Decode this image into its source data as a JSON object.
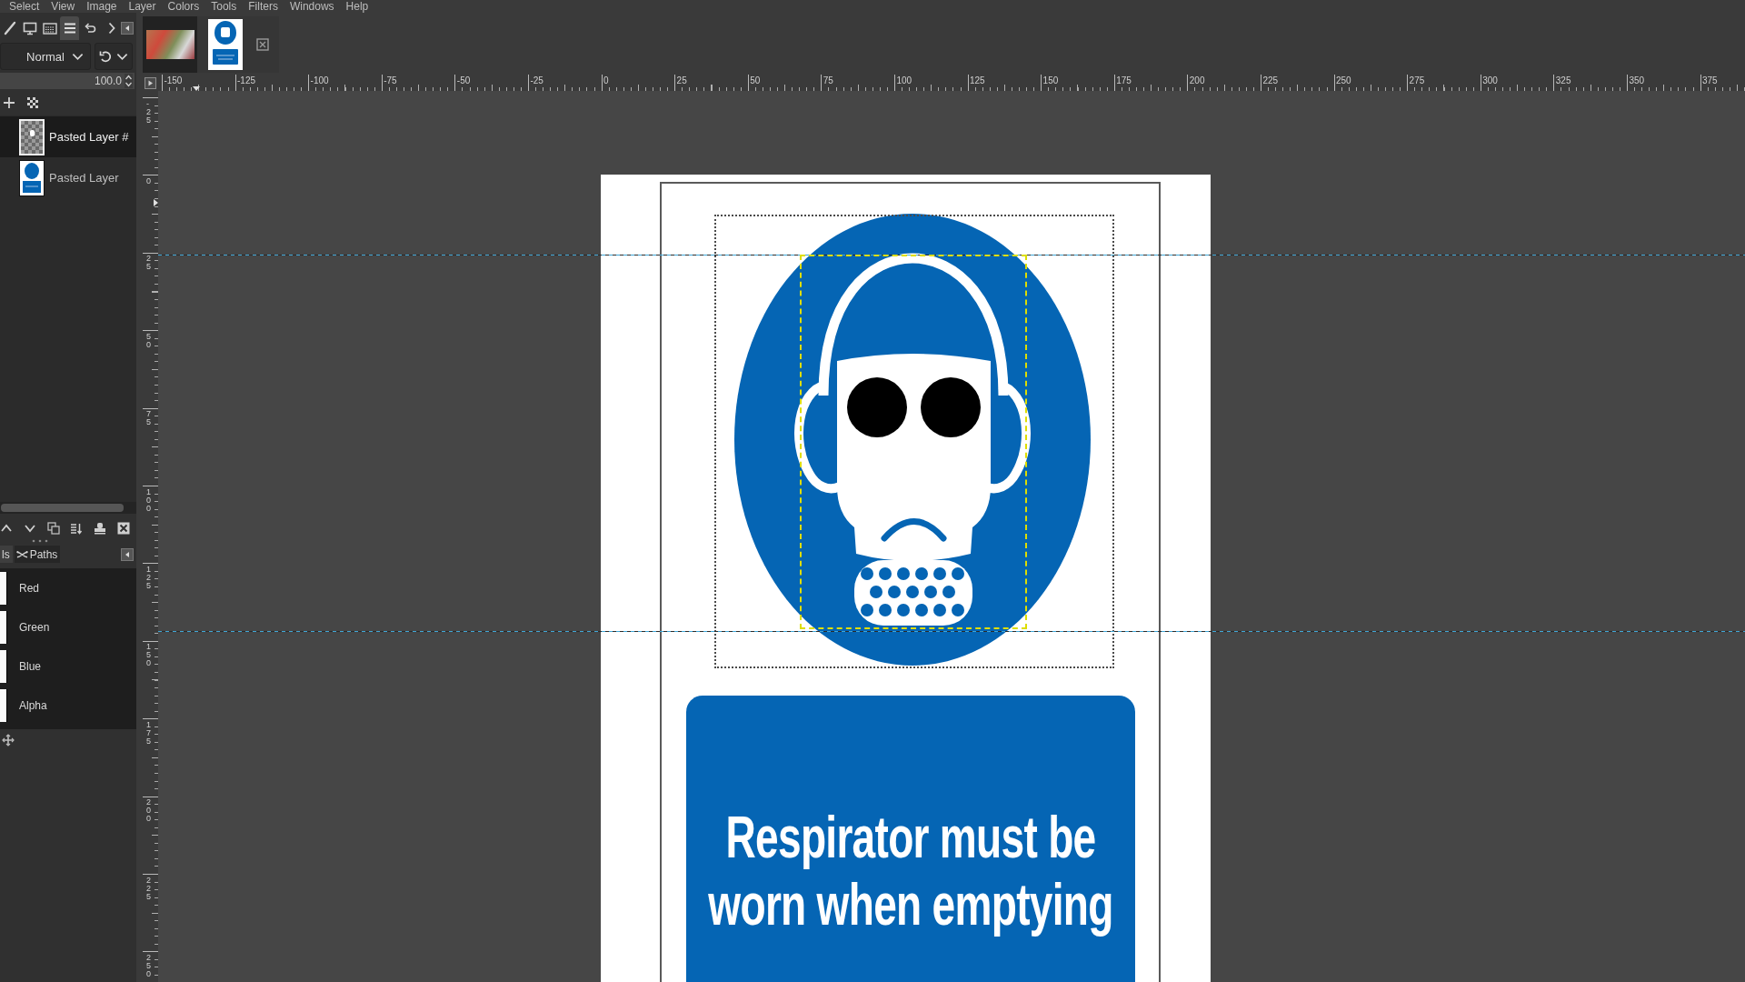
{
  "menu_bar": [
    "Select",
    "View",
    "Image",
    "Layer",
    "Colors",
    "Tools",
    "Filters",
    "Windows",
    "Help"
  ],
  "dock_tabs": [
    {
      "kind": "brushes",
      "selected": false
    },
    {
      "kind": "devices",
      "selected": false
    },
    {
      "kind": "images",
      "selected": false
    },
    {
      "kind": "layers",
      "selected": true
    },
    {
      "kind": "undo",
      "selected": false
    }
  ],
  "layers_panel": {
    "mode": "Normal",
    "opacity": "100.0",
    "layers": [
      {
        "name": "Pasted Layer #",
        "kind": "transparent",
        "selected": true
      },
      {
        "name": "Pasted Layer",
        "kind": "sign",
        "selected": false
      }
    ]
  },
  "lower_dock_tabs": [
    {
      "label": "ls",
      "kind": "channels",
      "selected": true
    },
    {
      "label": "Paths",
      "kind": "paths",
      "selected": false
    }
  ],
  "channels": [
    {
      "name": "Red"
    },
    {
      "name": "Green"
    },
    {
      "name": "Blue"
    },
    {
      "name": "Alpha"
    }
  ],
  "image_tabs": [
    {
      "kind": "photo",
      "selected": false
    },
    {
      "kind": "sign",
      "selected": true
    }
  ],
  "rulers": {
    "horizontal": [
      "-150",
      "-125",
      "-100",
      "-75",
      "-50",
      "-25",
      "0",
      "25",
      "50",
      "75",
      "100",
      "125",
      "150",
      "175",
      "200",
      "225",
      "250",
      "275",
      "300",
      "325",
      "350",
      "375"
    ],
    "vertical": [
      "-25",
      "0",
      "25",
      "50",
      "75",
      "100",
      "125",
      "150",
      "175",
      "200",
      "225",
      "250"
    ]
  },
  "canvas": {
    "sign_text": "Respirator must be worn when emptying"
  }
}
